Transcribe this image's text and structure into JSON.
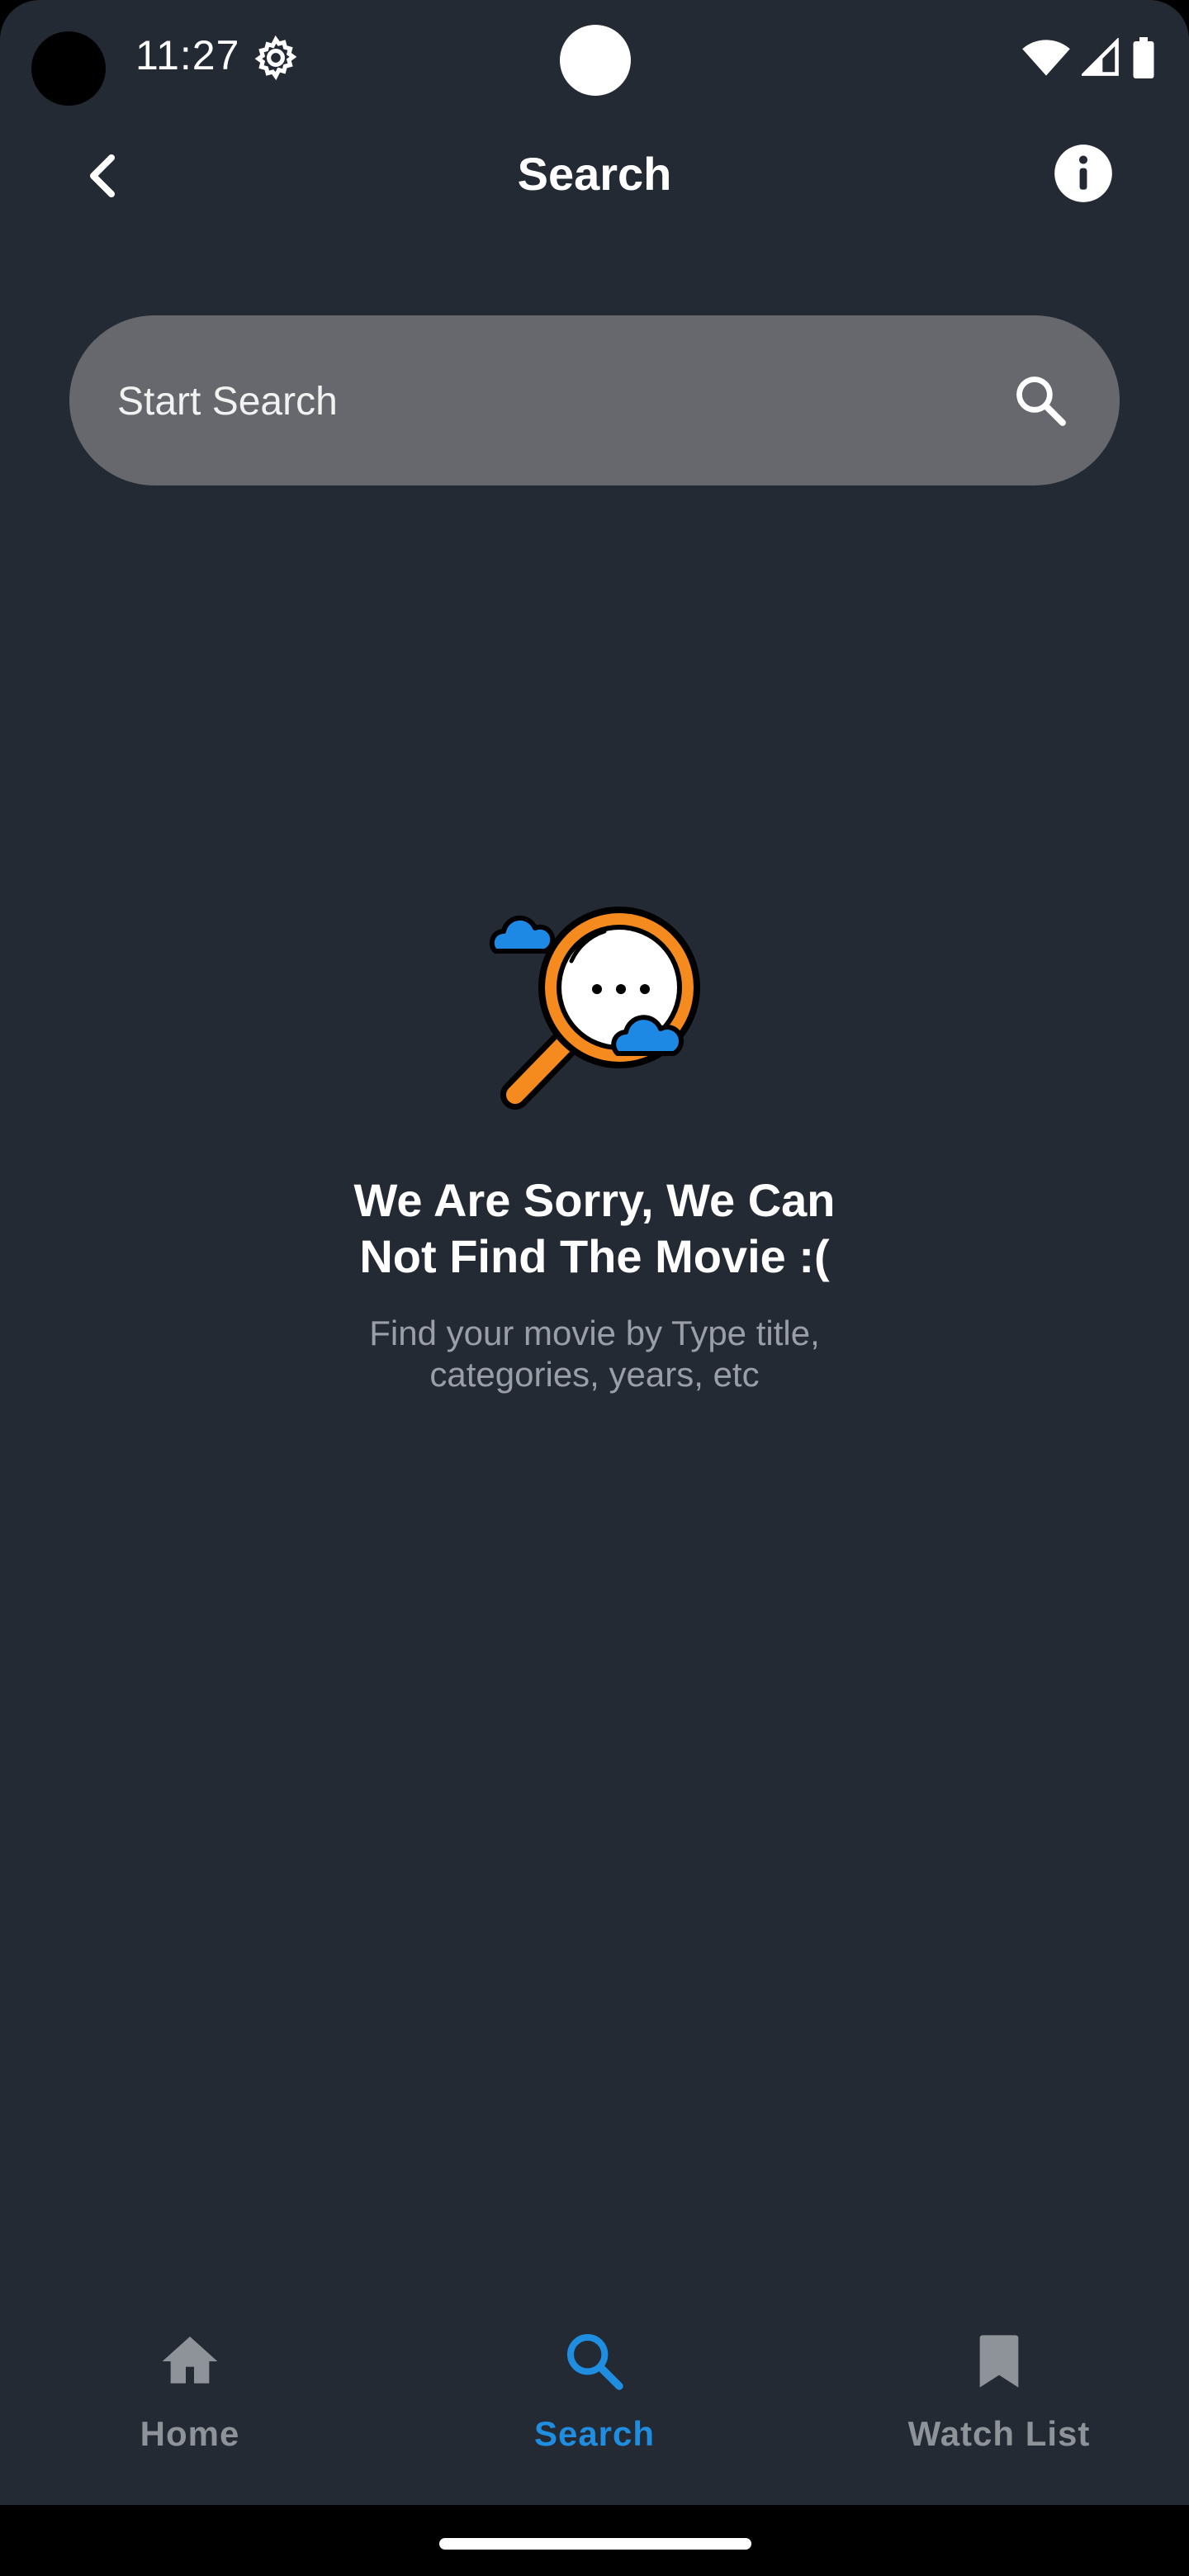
{
  "status_bar": {
    "time": "11:27",
    "icons": [
      "settings-gear-icon",
      "wifi-icon",
      "cell-signal-icon",
      "battery-icon"
    ]
  },
  "app_bar": {
    "title": "Search",
    "back_icon": "chevron-left-icon",
    "info_icon": "info-icon"
  },
  "search": {
    "placeholder": "Start Search",
    "value": "",
    "icon": "search-icon"
  },
  "empty_state": {
    "illustration": "magnifier-with-clouds-illustration",
    "title_line1": "We Are Sorry, We Can",
    "title_line2": "Not Find The Movie :(",
    "subtitle_line1": "Find your movie by Type title,",
    "subtitle_line2": "categories, years, etc"
  },
  "bottom_nav": {
    "items": [
      {
        "label": "Home",
        "icon": "home-icon",
        "active": false
      },
      {
        "label": "Search",
        "icon": "search-icon",
        "active": true
      },
      {
        "label": "Watch List",
        "icon": "bookmark-icon",
        "active": false
      }
    ]
  },
  "colors": {
    "background": "#242a34",
    "search_bar": "#66686d",
    "accent": "#1f8ee0",
    "inactive": "#8e9299",
    "text_primary": "#ffffff",
    "text_secondary": "#9a9ea6",
    "illustration_orange": "#f58a1f",
    "illustration_blue": "#1e88e5"
  }
}
